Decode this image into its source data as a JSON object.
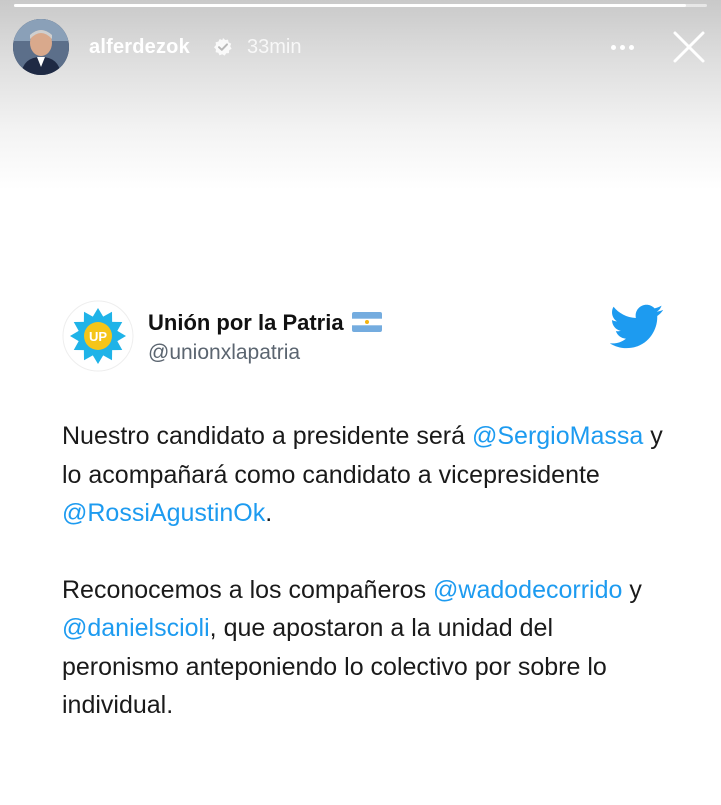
{
  "story": {
    "progress_fraction": 0.97,
    "username": "alferdezok",
    "time": "33min"
  },
  "icons": {
    "verified": "verified-badge-icon",
    "more": "more-options-icon",
    "close": "close-icon",
    "twitter": "twitter-bird-icon",
    "flag": "argentina-flag-icon"
  },
  "colors": {
    "mention": "#1d9bf0",
    "twitter_blue": "#1d9bf0",
    "logo_blue": "#1fb3e8",
    "logo_yellow": "#f5c518"
  },
  "tweet": {
    "logo_text": "UP",
    "display_name": "Unión por la Patria",
    "handle": "@unionxlapatria",
    "p1": {
      "t1": "Nuestro candidato a presidente será ",
      "m1": "@SergioMassa",
      "t2": " y lo acompañará como candidato a vicepresidente ",
      "m2": "@RossiAgustinOk",
      "t3": "."
    },
    "p2": {
      "t1": "Reconocemos a los compañeros ",
      "m1": "@wadodecorrido",
      "t2": " y ",
      "m2": "@danielscioli",
      "t3": ", que apostaron a la unidad del peronismo anteponiendo lo colectivo por sobre lo individual."
    }
  }
}
